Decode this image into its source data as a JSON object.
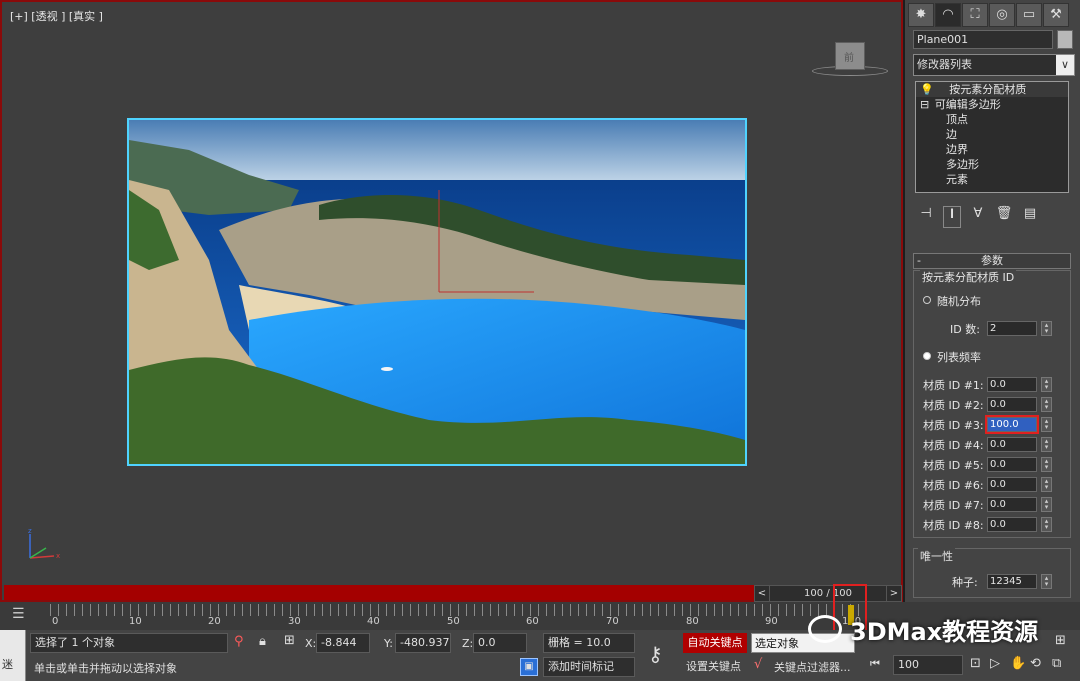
{
  "viewport": {
    "label": "[+] [透视 ] [真实 ]",
    "cube_label": "前"
  },
  "time_slider": {
    "prev": "<",
    "value": "100 / 100",
    "next": ">"
  },
  "ruler": {
    "ticks": [
      "0",
      "10",
      "20",
      "30",
      "40",
      "50",
      "60",
      "70",
      "80",
      "90",
      "100"
    ]
  },
  "status": {
    "left_hint": "迷",
    "selection": "选择了 1 个对象",
    "prompt": "单击或单击并拖动以选择对象",
    "x_label": "X:",
    "x_value": "-8.844",
    "y_label": "Y:",
    "y_value": "-480.937",
    "z_label": "Z:",
    "z_value": "0.0",
    "grid": "栅格 = 10.0",
    "add_time_tag": "添加时间标记",
    "auto_key": "自动关键点",
    "set_key": "设置关键点",
    "selected_object": "选定对象",
    "key_filter": "关键点过滤器...",
    "frame_field": "100"
  },
  "watermark": "3DMax教程资源",
  "panel": {
    "tabs": [
      "✸",
      "◠",
      "⛶",
      "◎",
      "▭",
      "⚒"
    ],
    "object_name": "Plane001",
    "modifier_list": "修改器列表",
    "stack": [
      {
        "icon": "💡",
        "label": "按元素分配材质",
        "indent": 20
      },
      {
        "icon": "⊟",
        "label": "可编辑多边形",
        "indent": 4
      },
      {
        "icon": "",
        "label": "顶点",
        "indent": 28
      },
      {
        "icon": "",
        "label": "边",
        "indent": 28
      },
      {
        "icon": "",
        "label": "边界",
        "indent": 28
      },
      {
        "icon": "",
        "label": "多边形",
        "indent": 28
      },
      {
        "icon": "",
        "label": "元素",
        "indent": 28
      }
    ],
    "rollout_title": "参数",
    "rollout_minus": "-",
    "group_title": "按元素分配材质 ID",
    "random_label": "随机分布",
    "id_count_label": "ID 数:",
    "id_count_value": "2",
    "list_freq_label": "列表频率",
    "materials": [
      {
        "label": "材质 ID #1:",
        "value": "0.0"
      },
      {
        "label": "材质 ID #2:",
        "value": "0.0"
      },
      {
        "label": "材质 ID #3:",
        "value": "100.0"
      },
      {
        "label": "材质 ID #4:",
        "value": "0.0"
      },
      {
        "label": "材质 ID #5:",
        "value": "0.0"
      },
      {
        "label": "材质 ID #6:",
        "value": "0.0"
      },
      {
        "label": "材质 ID #7:",
        "value": "0.0"
      },
      {
        "label": "材质 ID #8:",
        "value": "0.0"
      }
    ],
    "unique_title": "唯一性",
    "seed_label": "种子:",
    "seed_value": "12345"
  }
}
